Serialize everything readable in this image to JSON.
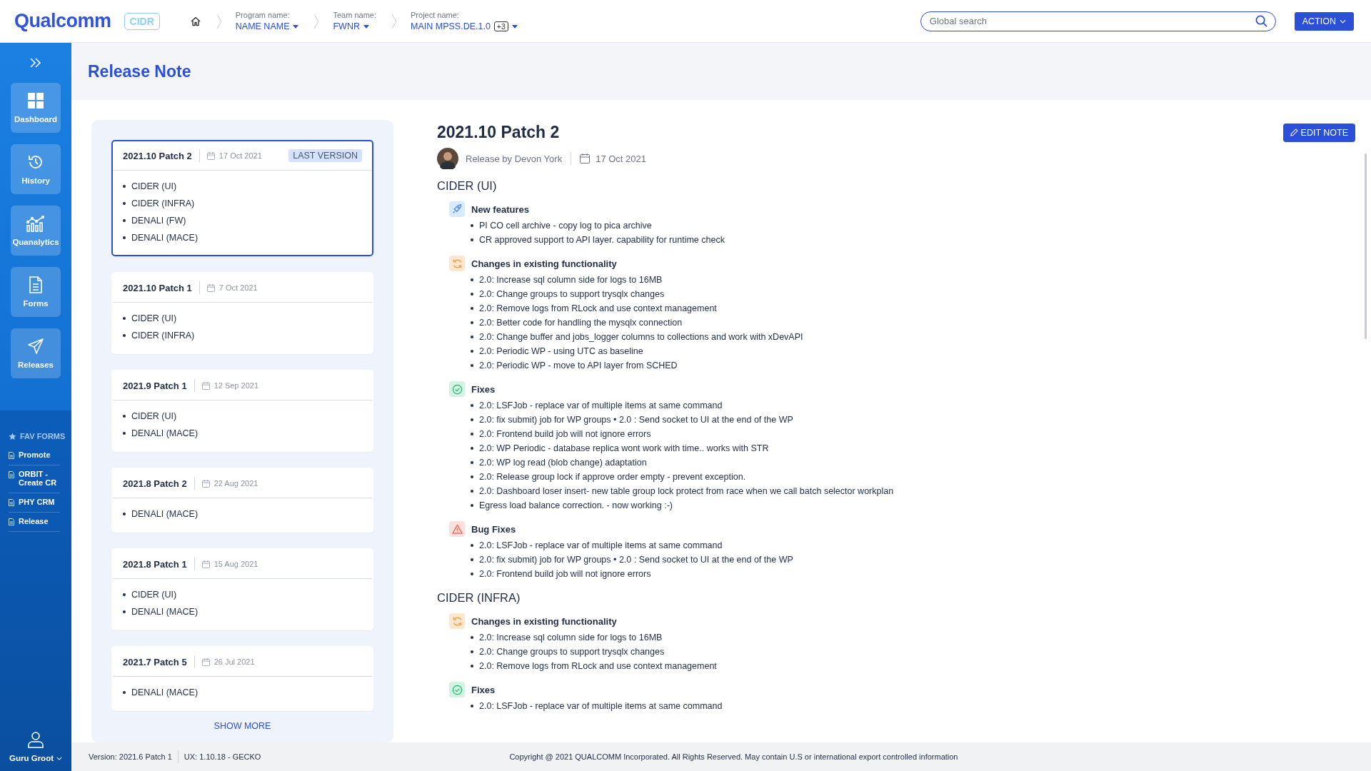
{
  "header": {
    "logo": "Qualcomm",
    "app_badge": "CIDR",
    "breadcrumbs": [
      {
        "label": "Program name:",
        "value": "NAME NAME"
      },
      {
        "label": "Team name:",
        "value": "FWNR"
      },
      {
        "label": "Project name:",
        "value": "MAIN MPSS.DE.1.0",
        "extra": "+3"
      }
    ],
    "search": {
      "placeholder": "Global search"
    },
    "action_button": "ACTION"
  },
  "sidebar": {
    "nav": [
      {
        "label": "Dashboard",
        "kind": "dashboard"
      },
      {
        "label": "History",
        "kind": "history"
      },
      {
        "label": "Quanalytics",
        "kind": "analytics"
      },
      {
        "label": "Forms",
        "kind": "forms"
      },
      {
        "label": "Releases",
        "kind": "releases"
      }
    ],
    "fav_title": "FAV FORMS",
    "fav_items": [
      "Promote",
      "ORBIT - Create CR",
      "PHY CRM",
      "Release"
    ],
    "user": "Guru Groot"
  },
  "page_title": "Release Note",
  "releases": [
    {
      "title": "2021.10 Patch 2",
      "date": "17 Oct 2021",
      "tag": "LAST VERSION",
      "selected": true,
      "components": [
        "CIDER (UI)",
        "CIDER (INFRA)",
        "DENALI (FW)",
        "DENALI (MACE)"
      ]
    },
    {
      "title": "2021.10 Patch 1",
      "date": "7 Oct 2021",
      "selected": false,
      "components": [
        "CIDER (UI)",
        "CIDER (INFRA)"
      ]
    },
    {
      "title": "2021.9 Patch 1",
      "date": "12 Sep 2021",
      "selected": false,
      "components": [
        "CIDER (UI)",
        "DENALI (MACE)"
      ]
    },
    {
      "title": "2021.8 Patch 2",
      "date": "22 Aug 2021",
      "selected": false,
      "components": [
        "DENALI (MACE)"
      ]
    },
    {
      "title": "2021.8 Patch 1",
      "date": "15 Aug 2021",
      "selected": false,
      "components": [
        "CIDER (UI)",
        "DENALI (MACE)"
      ]
    },
    {
      "title": "2021.7 Patch 5",
      "date": "26 Jul 2021",
      "selected": false,
      "components": [
        "DENALI (MACE)"
      ]
    }
  ],
  "show_more": "SHOW MORE",
  "detail": {
    "title": "2021.10 Patch 2",
    "author": "Release by Devon York",
    "date": "17 Oct 2021",
    "edit_button": "EDIT NOTE",
    "sections": [
      {
        "name": "CIDER (UI)",
        "groups": [
          {
            "kind": "features",
            "title": "New features",
            "items": [
              "PI CO cell archive - copy log to pica archive",
              "CR approved support to API layer. capability for runtime check"
            ]
          },
          {
            "kind": "changes",
            "title": "Changes in existing functionality",
            "items": [
              "2.0: Increase sql column side for logs to 16MB",
              "2.0: Change groups to support trysqlx changes",
              "2.0: Remove logs from RLock and use context management",
              "2.0: Better code for handling the mysqlx connection",
              "2.0: Change buffer and jobs_logger columns to collections and work with xDevAPI",
              "2.0: Periodic WP - using UTC as baseline",
              "2.0: Periodic WP - move to API layer from SCHED"
            ]
          },
          {
            "kind": "fixes",
            "title": "Fixes",
            "items": [
              "2.0: LSFJob - replace var of multiple items at same command",
              "2.0: fix submit) job for WP groups • 2.0 : Send socket to UI at the end of the WP",
              "2.0: Frontend build job will not ignore errors",
              "2.0: WP Periodic - database replica wont work with time.. works with STR",
              "2.0: WP log read (blob change) adaptation",
              "2.0: Release group lock if approve order empty - prevent exception.",
              "2.0: Dashboard loser insert- new table group lock protect from race when we call batch selector workplan",
              "Egress load balance correction. - now working :-)"
            ]
          },
          {
            "kind": "bugs",
            "title": "Bug Fixes",
            "items": [
              "2.0: LSFJob - replace var of multiple items at same command",
              "2.0: fix submit) job for WP groups • 2.0 : Send socket to UI at the end of the WP",
              "2.0: Frontend build job will not ignore errors"
            ]
          }
        ]
      },
      {
        "name": "CIDER (INFRA)",
        "groups": [
          {
            "kind": "changes",
            "title": "Changes in existing functionality",
            "items": [
              "2.0: Increase sql column side for logs to 16MB",
              "2.0: Change groups to support trysqlx changes",
              "2.0: Remove logs from RLock and use context management"
            ]
          },
          {
            "kind": "fixes",
            "title": "Fixes",
            "items": [
              "2.0: LSFJob - replace var of multiple items at same command"
            ]
          }
        ]
      }
    ]
  },
  "footer": {
    "version": "Version: 2021.6 Patch 1",
    "ux": "UX: 1.10.18 - GECKO",
    "copyright": "Copyright @ 2021 QUALCOMM Incorporated. All Rights Reserved. May contain U.S or international export controlled information"
  }
}
